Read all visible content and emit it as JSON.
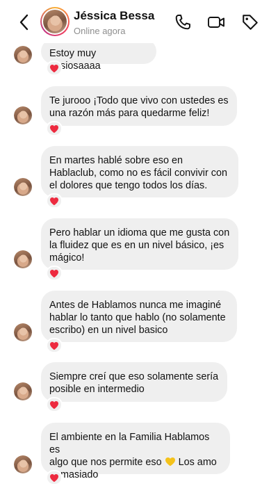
{
  "header": {
    "contact_name": "Jéssica Bessa",
    "status": "Online agora",
    "icons": [
      "back-chevron-icon",
      "phone-icon",
      "video-call-icon",
      "tag-icon"
    ]
  },
  "colors": {
    "bubble": "#efefef",
    "heart": "#ed2a3f",
    "yellow_heart": "#f4c21b"
  },
  "messages": [
    {
      "lines": [
        "Estoy muy ansiosaaaa"
      ],
      "reaction": "❤️"
    },
    {
      "lines": [
        "Te jurooo ¡Todo que vivo con ustedes es",
        "una razón más para quedarme feliz!"
      ],
      "reaction": "❤️"
    },
    {
      "lines": [
        "En martes hablé sobre eso en",
        "Hablaclub, como no es fácil convivir con",
        "el dolores que tengo todos los días."
      ],
      "reaction": "❤️"
    },
    {
      "lines": [
        "Pero hablar un idioma que me gusta con",
        "la fluidez que es en un nivel básico, ¡es",
        "mágico!"
      ],
      "reaction": "❤️"
    },
    {
      "lines": [
        "Antes de Hablamos nunca me imaginé",
        "hablar lo tanto que hablo (no solamente",
        "escribo) en un nivel basico"
      ],
      "reaction": "❤️"
    },
    {
      "lines": [
        "Siempre creí que eso solamente sería",
        "posible en intermedio"
      ],
      "reaction": "❤️"
    },
    {
      "lines": [
        "El ambiente en la Familia Hablamos es",
        "algo que nos permite eso",
        "Los amo",
        "demasiado"
      ],
      "reaction": "❤️",
      "emoji": "yellow-heart"
    }
  ]
}
